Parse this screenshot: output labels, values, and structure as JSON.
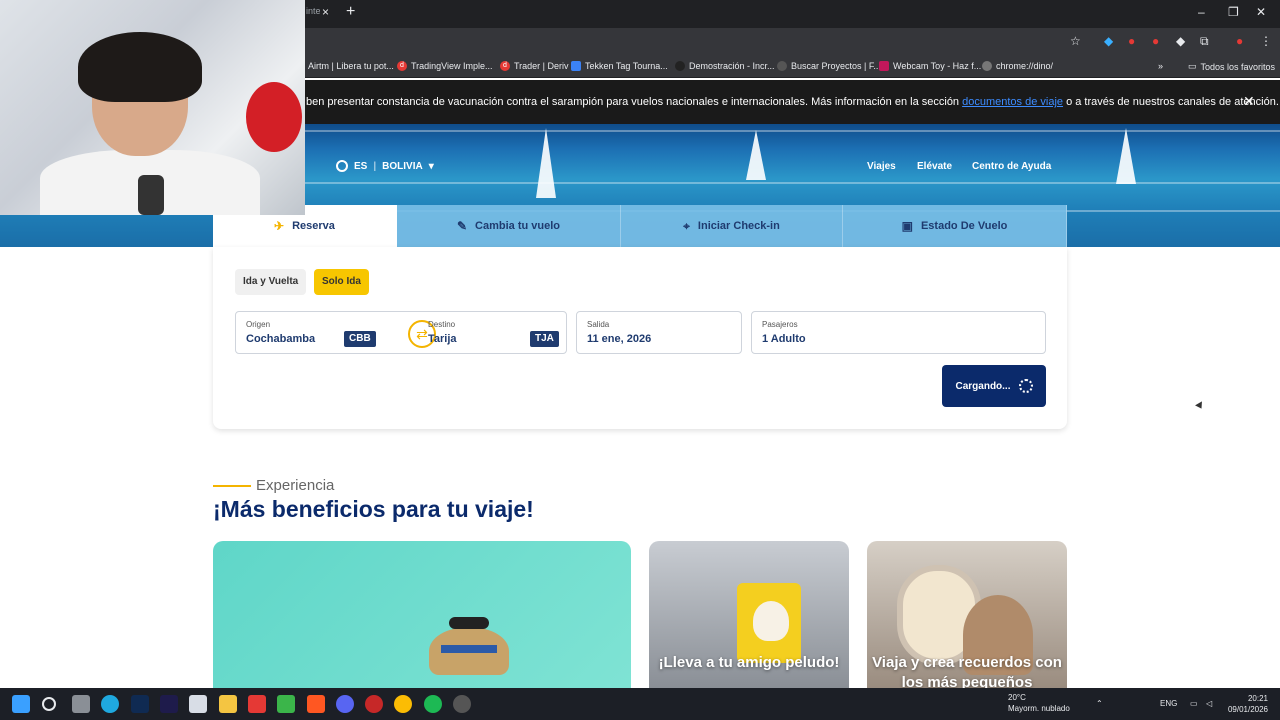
{
  "browser": {
    "tab_partial_title": "inte",
    "tab_close": "×",
    "new_tab": "+",
    "window_controls": [
      "–",
      "❐",
      "✕"
    ],
    "toolbar_icons": [
      "star-icon",
      "extension-icon",
      "menu-icon"
    ],
    "bookmarks": [
      {
        "label": "Airtm | Libera tu pot...",
        "icon_color": "#3aa0ff"
      },
      {
        "label": "TradingView Imple...",
        "icon_color": "#e53935"
      },
      {
        "label": "Trader | Deriv",
        "icon_color": "#e53935"
      },
      {
        "label": "Tekken Tag Tourna...",
        "icon_color": "#3b82f6"
      },
      {
        "label": "Demostración - Incr...",
        "icon_color": "#222222"
      },
      {
        "label": "Buscar Proyectos | F...",
        "icon_color": "#555555"
      },
      {
        "label": "Webcam Toy - Haz f...",
        "icon_color": "#c2185b"
      },
      {
        "label": "chrome://dino/",
        "icon_color": "#777777"
      }
    ],
    "bookmarks_more": "»",
    "all_bookmarks": "Todos los favoritos"
  },
  "notice": {
    "text_before": "ben presentar constancia de vacunación contra el sarampión para vuelos nacionales e internacionales. Más información en la sección ",
    "link": "documentos de viaje",
    "text_after": " o a través de nuestros canales de atención.",
    "close": "✕"
  },
  "header": {
    "language": "ES",
    "country": "BOLIVIA",
    "nav": [
      "Viajes",
      "Elévate",
      "Centro de Ayuda"
    ]
  },
  "tabs": [
    {
      "label": "Reserva",
      "icon": "plane-icon",
      "active": true
    },
    {
      "label": "Cambia tu vuelo",
      "icon": "edit-icon",
      "active": false
    },
    {
      "label": "Iniciar Check-in",
      "icon": "pin-icon",
      "active": false
    },
    {
      "label": "Estado De Vuelo",
      "icon": "screen-icon",
      "active": false
    }
  ],
  "booking": {
    "trip_round": "Ida y Vuelta",
    "trip_one": "Solo Ida",
    "origin_label": "Origen",
    "origin_value": "Cochabamba",
    "origin_code": "CBB",
    "destination_label": "Destino",
    "destination_value": "Tarija",
    "destination_code": "TJA",
    "date_label": "Salida",
    "date_value": "11 ene, 2026",
    "passengers_label": "Pasajeros",
    "passengers_value": "1 Adulto",
    "submit_label": "Cargando..."
  },
  "experience": {
    "kicker": "Experiencia",
    "title": "¡Más beneficios para tu viaje!",
    "cards": [
      {
        "text": ""
      },
      {
        "text": "¡Lleva a tu amigo peludo!"
      },
      {
        "text": "Viaja y crea recuerdos con los más pequeños"
      }
    ]
  },
  "taskbar": {
    "weather_temp": "20°C",
    "weather_desc": "Mayorm. nublado",
    "language": "ENG",
    "time": "20:21",
    "date": "09/01/2026"
  },
  "colors": {
    "brand_navy": "#0b2a6b",
    "accent_yellow": "#f4b400",
    "tab_inactive": "#78bee6"
  }
}
